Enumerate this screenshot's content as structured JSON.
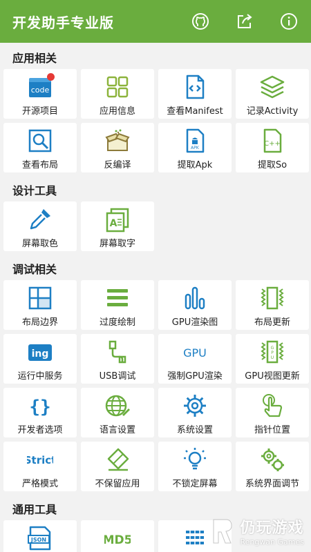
{
  "app": {
    "title": "开发助手专业版",
    "accent": "#6aad3e",
    "actions": [
      {
        "icon": "github-icon"
      },
      {
        "icon": "share-icon"
      },
      {
        "icon": "info-icon"
      }
    ]
  },
  "sections": [
    {
      "title": "应用相关",
      "items": [
        {
          "label": "开源项目",
          "icon": "code-icon",
          "badge": true
        },
        {
          "label": "应用信息",
          "icon": "grid-apps-icon"
        },
        {
          "label": "查看Manifest",
          "icon": "file-code-icon"
        },
        {
          "label": "记录Activity",
          "icon": "layers-icon"
        },
        {
          "label": "查看布局",
          "icon": "layout-inspect-icon"
        },
        {
          "label": "反编译",
          "icon": "gift-box-icon"
        },
        {
          "label": "提取Apk",
          "icon": "apk-file-icon"
        },
        {
          "label": "提取So",
          "icon": "so-file-icon"
        }
      ]
    },
    {
      "title": "设计工具",
      "items": [
        {
          "label": "屏幕取色",
          "icon": "eyedropper-icon"
        },
        {
          "label": "屏幕取字",
          "icon": "text-capture-icon"
        }
      ]
    },
    {
      "title": "调试相关",
      "items": [
        {
          "label": "布局边界",
          "icon": "layout-bounds-icon"
        },
        {
          "label": "过度绘制",
          "icon": "overdraw-icon"
        },
        {
          "label": "GPU渲染图",
          "icon": "bar-chart-icon"
        },
        {
          "label": "布局更新",
          "icon": "layout-update-icon"
        },
        {
          "label": "运行中服务",
          "icon": "ing-icon"
        },
        {
          "label": "USB调试",
          "icon": "usb-icon"
        },
        {
          "label": "强制GPU渲染",
          "icon": "gpu-text-icon"
        },
        {
          "label": "GPU视图更新",
          "icon": "gpu-chip-icon"
        },
        {
          "label": "开发者选项",
          "icon": "braces-icon"
        },
        {
          "label": "语言设置",
          "icon": "globe-icon"
        },
        {
          "label": "系统设置",
          "icon": "gear-icon"
        },
        {
          "label": "指针位置",
          "icon": "pointer-icon"
        },
        {
          "label": "严格模式",
          "icon": "strict-icon"
        },
        {
          "label": "不保留应用",
          "icon": "eraser-icon"
        },
        {
          "label": "不锁定屏幕",
          "icon": "bulb-icon"
        },
        {
          "label": "系统界面调节",
          "icon": "gears-icon"
        }
      ]
    },
    {
      "title": "通用工具",
      "items": [
        {
          "label": "",
          "icon": "json-icon",
          "text": "JSON"
        },
        {
          "label": "",
          "icon": "md5-icon",
          "text": "MD5"
        },
        {
          "label": "",
          "icon": "list-icon"
        }
      ]
    }
  ],
  "watermark": {
    "main": "仍玩游戏",
    "sub": "Rengwan Games"
  }
}
